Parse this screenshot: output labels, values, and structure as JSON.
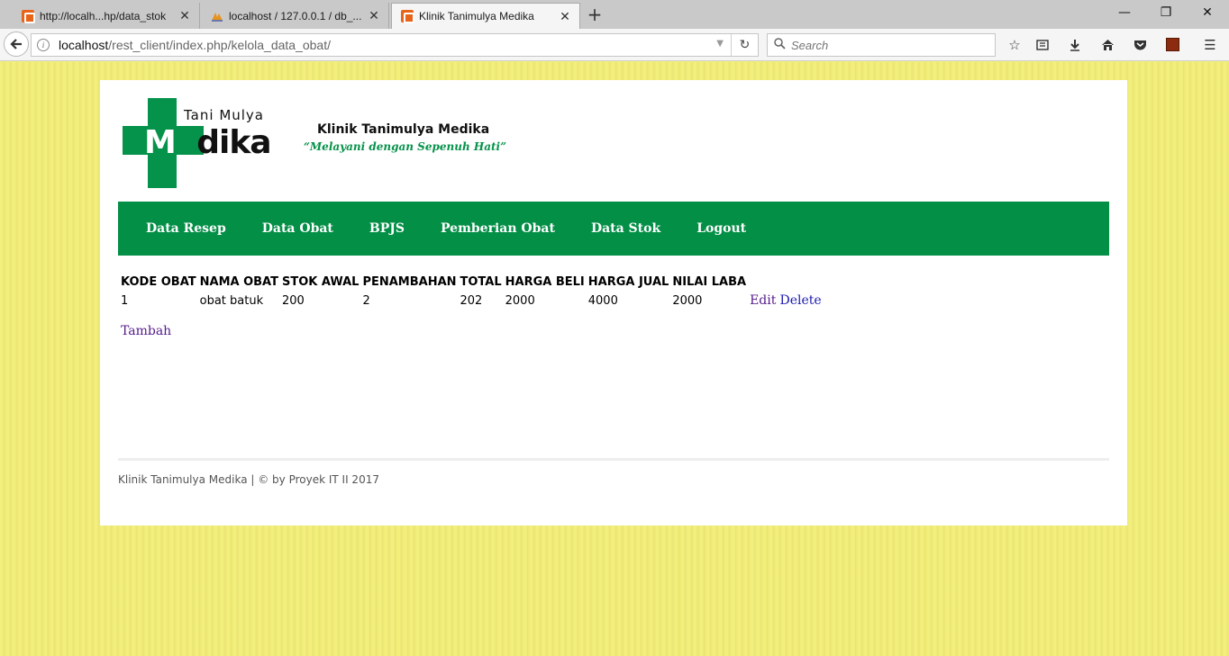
{
  "browser": {
    "tabs": [
      {
        "title": "http://localh...hp/data_stok",
        "icon": "xampp-icon",
        "active": false
      },
      {
        "title": "localhost / 127.0.0.1 / db_...",
        "icon": "phpmyadmin-icon",
        "active": false
      },
      {
        "title": "Klinik Tanimulya Medika",
        "icon": "xampp-icon",
        "active": true
      }
    ],
    "url_host": "localhost",
    "url_path": "/rest_client/index.php/kelola_data_obat/",
    "search_placeholder": "Search"
  },
  "header": {
    "logo_top": "Tani Mulya",
    "logo_word_me_white": "M",
    "logo_word_me_green": "e",
    "logo_word_rest": "dika",
    "clinic_name": "Klinik Tanimulya Medika",
    "tagline": "“Melayani dengan Sepenuh Hati”"
  },
  "menu": {
    "items": [
      "Data Resep",
      "Data Obat",
      "BPJS",
      "Pemberian Obat",
      "Data Stok",
      "Logout"
    ]
  },
  "table": {
    "headers": [
      "KODE OBAT",
      "NAMA OBAT",
      "STOK AWAL",
      "PENAMBAHAN",
      "TOTAL",
      "HARGA BELI",
      "HARGA JUAL",
      "NILAI LABA"
    ],
    "rows": [
      {
        "kode": "1",
        "nama": "obat batuk",
        "stok_awal": "200",
        "penambahan": "2",
        "total": "202",
        "harga_beli": "2000",
        "harga_jual": "4000",
        "nilai_laba": "2000",
        "edit_label": "Edit",
        "delete_label": "Delete"
      }
    ],
    "add_label": "Tambah"
  },
  "footer": {
    "text": "Klinik Tanimulya Medika | © by Proyek IT II 2017"
  },
  "colors": {
    "brand_green": "#038f46",
    "page_background": "#f2ee7a",
    "link": "#3c1aa8"
  }
}
